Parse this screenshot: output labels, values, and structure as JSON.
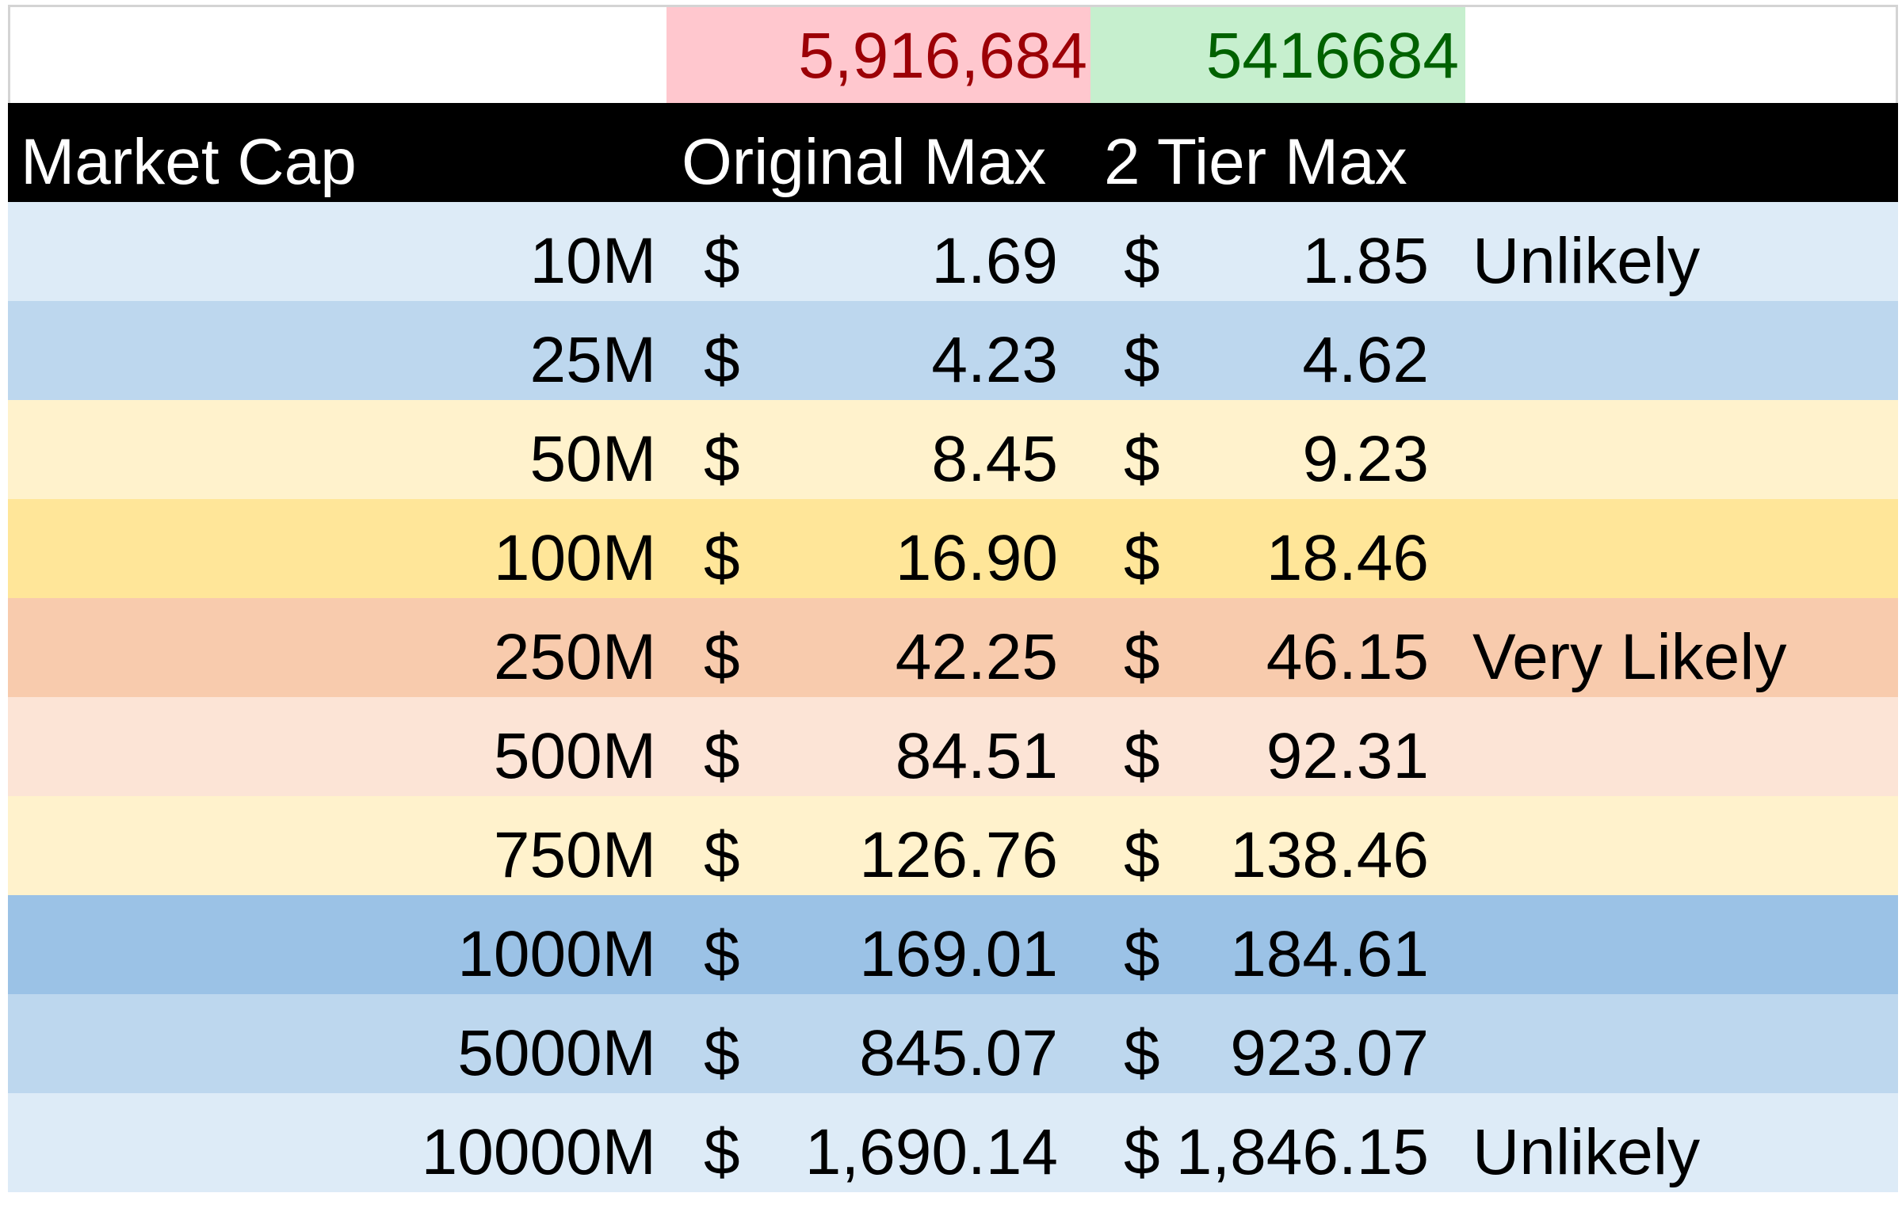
{
  "supply": {
    "original": "5,916,684",
    "tier": "5416684"
  },
  "header": {
    "market_cap": "Market Cap",
    "original_max": "Original Max",
    "tier_max": "2 Tier Max"
  },
  "colors": {
    "header_bg": "#000000",
    "header_text": "#ffffff",
    "supply_original_bg": "#ffc7ce",
    "supply_original_text": "#9c0006",
    "supply_tier_bg": "#c6efce",
    "supply_tier_text": "#006100"
  },
  "rows": [
    {
      "cap": "10M",
      "cur1": "$",
      "orig": "1.69",
      "cur2": "$",
      "tier": "1.85",
      "note": "Unlikely",
      "bg": "#ddebf7"
    },
    {
      "cap": "25M",
      "cur1": "$",
      "orig": "4.23",
      "cur2": "$",
      "tier": "4.62",
      "note": "",
      "bg": "#bdd7ee"
    },
    {
      "cap": "50M",
      "cur1": "$",
      "orig": "8.45",
      "cur2": "$",
      "tier": "9.23",
      "note": "",
      "bg": "#fff2cc"
    },
    {
      "cap": "100M",
      "cur1": "$",
      "orig": "16.90",
      "cur2": "$",
      "tier": "18.46",
      "note": "",
      "bg": "#ffe699"
    },
    {
      "cap": "250M",
      "cur1": "$",
      "orig": "42.25",
      "cur2": "$",
      "tier": "46.15",
      "note": "Very Likely",
      "bg": "#f8cbad"
    },
    {
      "cap": "500M",
      "cur1": "$",
      "orig": "84.51",
      "cur2": "$",
      "tier": "92.31",
      "note": "",
      "bg": "#fce4d6"
    },
    {
      "cap": "750M",
      "cur1": "$",
      "orig": "126.76",
      "cur2": "$",
      "tier": "138.46",
      "note": "",
      "bg": "#fff2cc"
    },
    {
      "cap": "1000M",
      "cur1": "$",
      "orig": "169.01",
      "cur2": "$",
      "tier": "184.61",
      "note": "",
      "bg": "#9bc2e6"
    },
    {
      "cap": "5000M",
      "cur1": "$",
      "orig": "845.07",
      "cur2": "$",
      "tier": "923.07",
      "note": "",
      "bg": "#bdd7ee"
    },
    {
      "cap": "10000M",
      "cur1": "$",
      "orig": "1,690.14",
      "cur2": "$",
      "tier": "1,846.15",
      "note": "Unlikely",
      "bg": "#ddebf7"
    }
  ]
}
